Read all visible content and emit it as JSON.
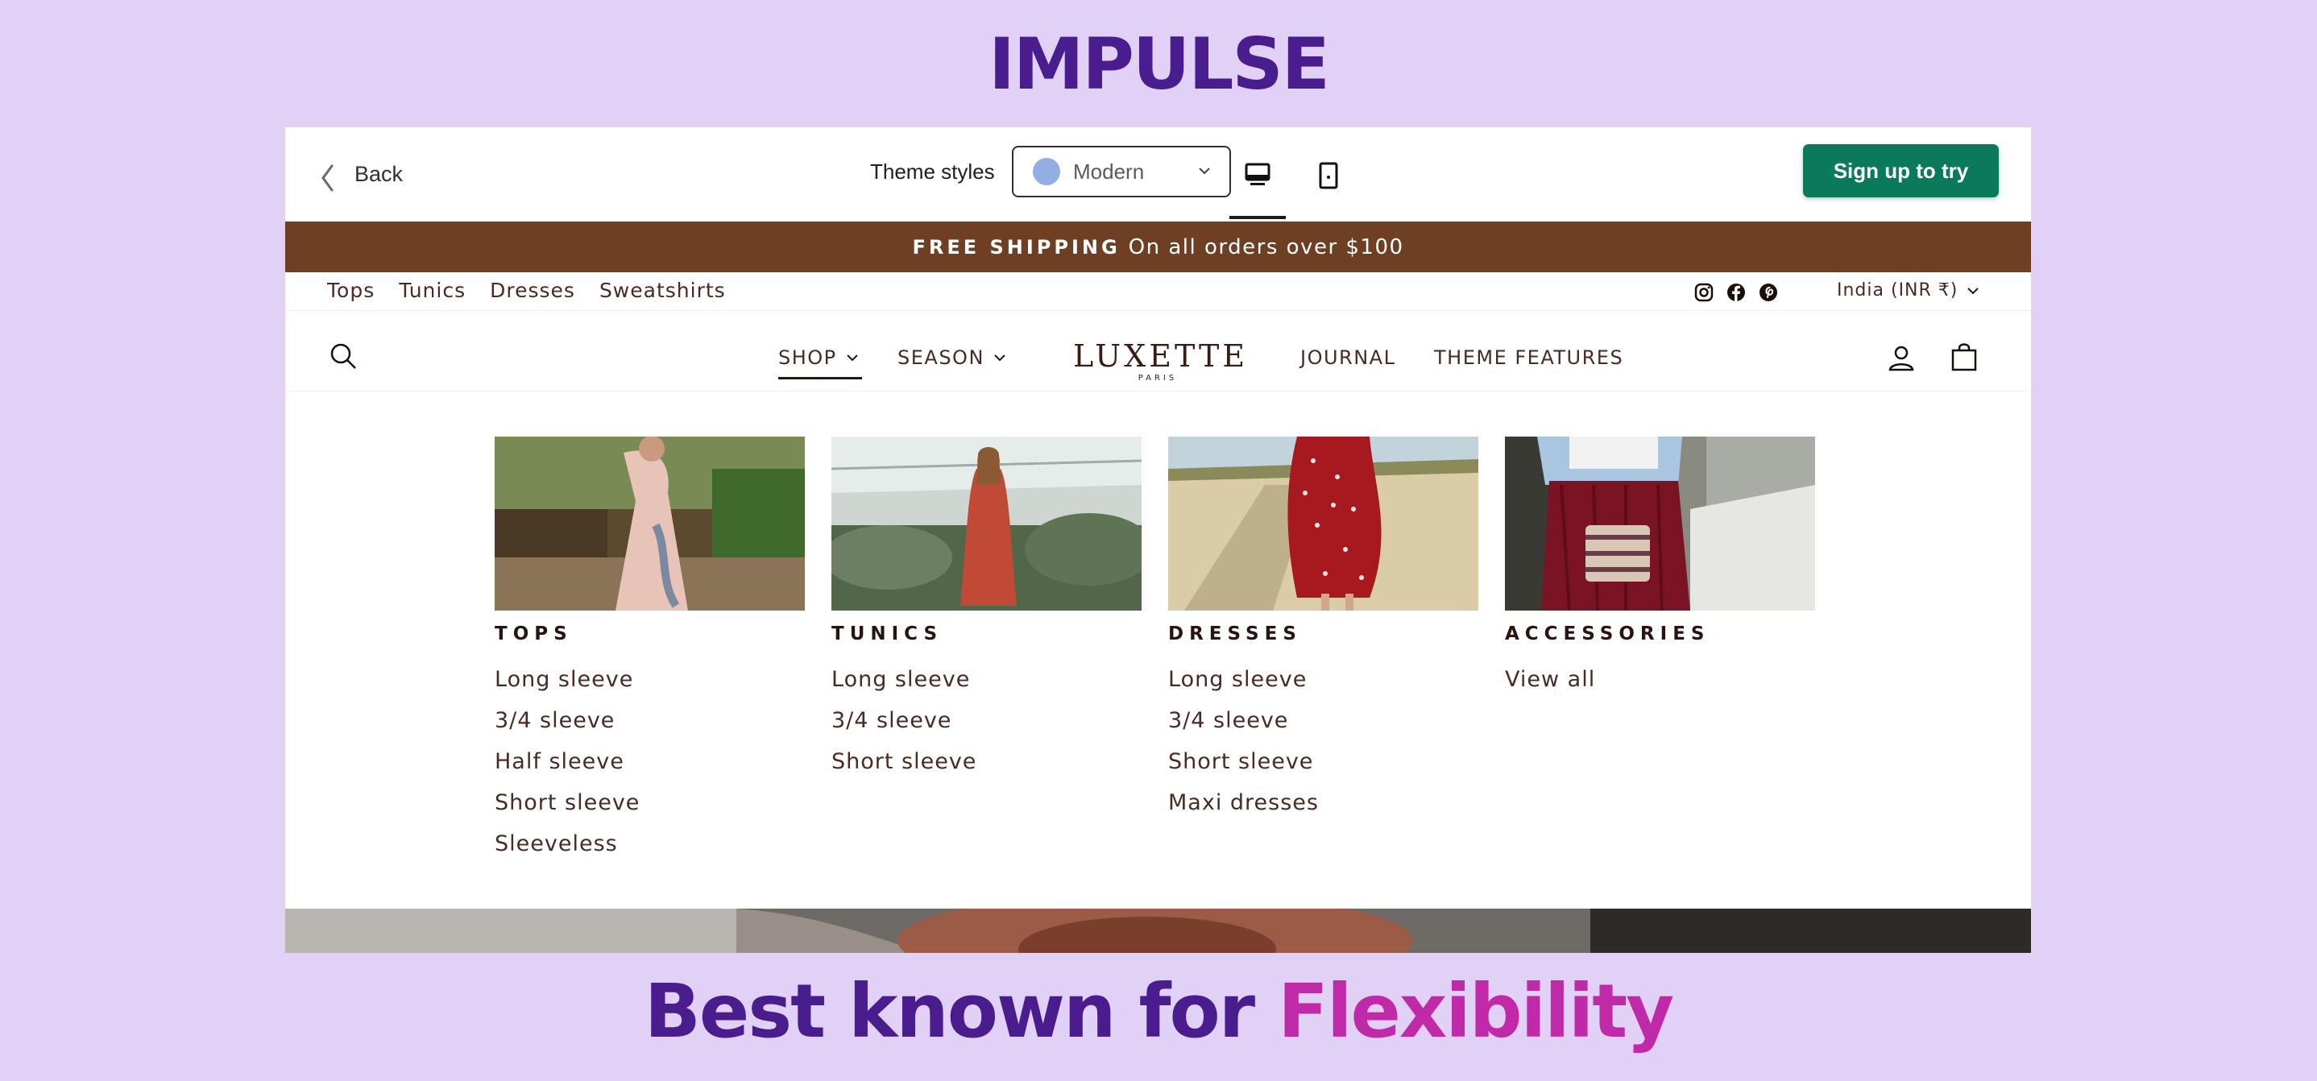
{
  "page_title": "IMPULSE",
  "tagline": {
    "lead": "Best known for ",
    "accent": "Flexibility"
  },
  "colors": {
    "background": "#e2d1f7",
    "title": "#4a1d8f",
    "accent": "#c02aa8",
    "signup": "#0a7a5a",
    "announcement_bg": "#6e3f23"
  },
  "preview_bar": {
    "back_label": "Back",
    "theme_styles_label": "Theme styles",
    "theme_select_value": "Modern",
    "devices": [
      "desktop-icon",
      "mobile-icon"
    ],
    "signup_label": "Sign up to try"
  },
  "announcement": {
    "strong": "FREE SHIPPING",
    "text": "On all orders over $100"
  },
  "utility_links": [
    "Tops",
    "Tunics",
    "Dresses",
    "Sweatshirts"
  ],
  "social_icons": [
    "instagram-icon",
    "facebook-icon",
    "pinterest-icon"
  ],
  "currency": "India (INR ₹)",
  "main_nav": {
    "shop": "SHOP",
    "season": "SEASON",
    "journal": "JOURNAL",
    "theme_features": "THEME FEATURES"
  },
  "logo": {
    "main": "LUXETTE",
    "sub": "PARIS"
  },
  "mega_menu": [
    {
      "title": "TOPS",
      "links": [
        "Long sleeve",
        "3/4 sleeve",
        "Half sleeve",
        "Short sleeve",
        "Sleeveless"
      ]
    },
    {
      "title": "TUNICS",
      "links": [
        "Long sleeve",
        "3/4 sleeve",
        "Short sleeve"
      ]
    },
    {
      "title": "DRESSES",
      "links": [
        "Long sleeve",
        "3/4 sleeve",
        "Short sleeve",
        "Maxi dresses"
      ]
    },
    {
      "title": "ACCESSORIES",
      "links": [
        "View all"
      ]
    }
  ]
}
